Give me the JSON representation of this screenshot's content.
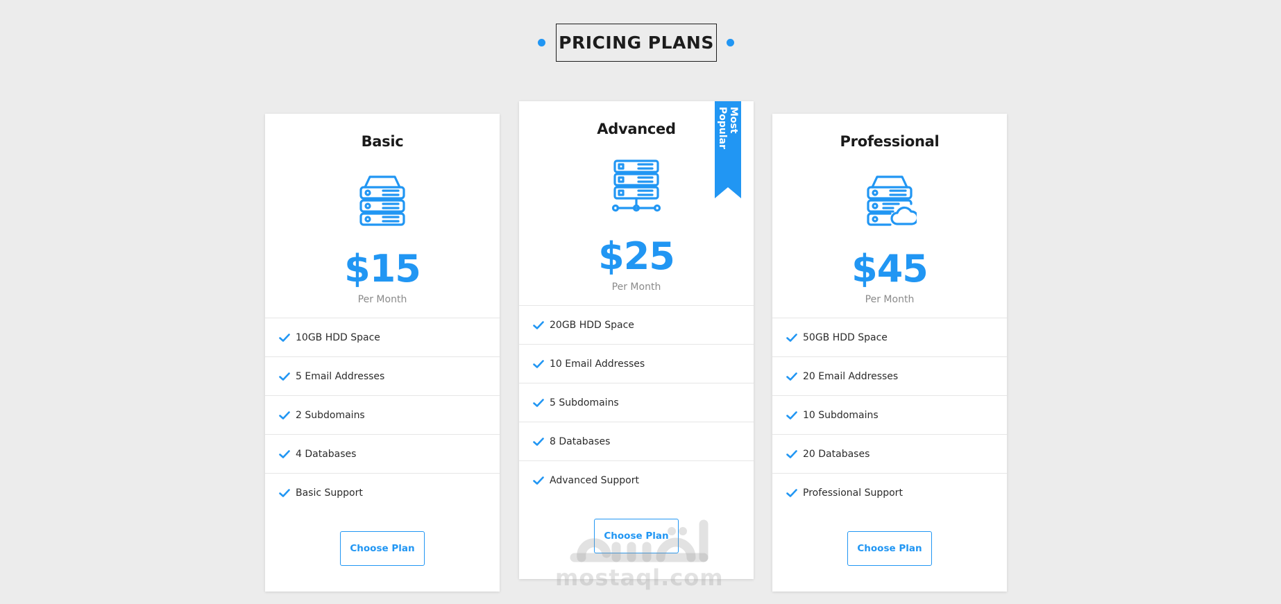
{
  "section": {
    "title": "PRICING PLANS"
  },
  "colors": {
    "accent": "#2196f3",
    "background": "#ececec",
    "card": "#ffffff",
    "divider": "#e6e6e6"
  },
  "plans": [
    {
      "name": "Basic",
      "icon": "server-stack-icon",
      "price": "$15",
      "period": "Per Month",
      "features": [
        "10GB HDD Space",
        "5 Email Addresses",
        "2 Subdomains",
        "4 Databases",
        "Basic Support"
      ],
      "button": "Choose Plan"
    },
    {
      "name": "Advanced",
      "icon": "server-network-icon",
      "price": "$25",
      "period": "Per Month",
      "badge": "Most Popular",
      "features": [
        "20GB HDD Space",
        "10 Email Addresses",
        "5 Subdomains",
        "8 Databases",
        "Advanced Support"
      ],
      "button": "Choose Plan"
    },
    {
      "name": "Professional",
      "icon": "server-cloud-icon",
      "price": "$45",
      "period": "Per Month",
      "features": [
        "50GB HDD Space",
        "20 Email Addresses",
        "10 Subdomains",
        "20 Databases",
        "Professional Support"
      ],
      "button": "Choose Plan"
    }
  ],
  "watermark": {
    "arabic": "مستقل",
    "latin": "mostaql.com"
  }
}
